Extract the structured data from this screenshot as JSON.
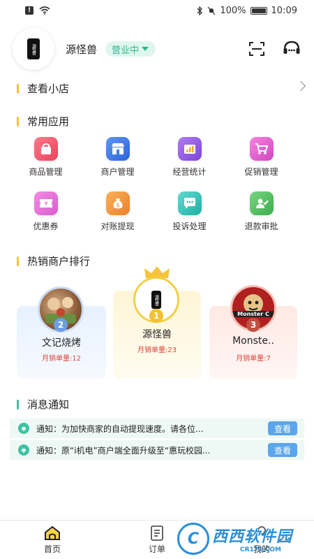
{
  "status_bar": {
    "battery": "100%",
    "time": "10:09"
  },
  "header": {
    "shop_name": "源怪兽",
    "status_label": "营业中",
    "logo_text": "源怪兽"
  },
  "view_shop": {
    "label": "查看小店"
  },
  "apps_section": {
    "title": "常用应用",
    "items": [
      {
        "label": "商品管理",
        "icon": "shopping-bag-icon",
        "color": "#f25a6e"
      },
      {
        "label": "商户管理",
        "icon": "store-icon",
        "color": "#3f7de8"
      },
      {
        "label": "经营统计",
        "icon": "stats-chart-icon",
        "color": "#9b5de5"
      },
      {
        "label": "促销管理",
        "icon": "cart-icon",
        "color": "#e85fd0"
      },
      {
        "label": "优惠券",
        "icon": "coupon-icon",
        "color": "#e76bd6"
      },
      {
        "label": "对账提现",
        "icon": "money-bag-icon",
        "color": "#f49a3a"
      },
      {
        "label": "投诉处理",
        "icon": "chat-icon",
        "color": "#2cc6b8"
      },
      {
        "label": "退款审批",
        "icon": "user-check-icon",
        "color": "#48c25b"
      }
    ]
  },
  "ranking": {
    "title": "热销商户排行",
    "items": [
      {
        "rank": "1",
        "name": "源怪兽",
        "sales": "月销单量:23"
      },
      {
        "rank": "2",
        "name": "文记烧烤",
        "sales": "月销单量:12"
      },
      {
        "rank": "3",
        "name": "Monste..",
        "sales": "月销单量:7",
        "logo_text": "Monster C"
      }
    ]
  },
  "notices": {
    "title": "消息通知",
    "items": [
      {
        "text": "通知：为加快商家的自动提现速度。请各位...",
        "button": "查看"
      },
      {
        "text": "通知：原“i机电”商户端全面升级至“惠玩校园...",
        "button": "查看"
      }
    ]
  },
  "bottom_nav": [
    {
      "label": "首页",
      "icon": "home-icon"
    },
    {
      "label": "订单",
      "icon": "order-icon"
    },
    {
      "label": "我的",
      "icon": "user-icon"
    }
  ],
  "watermark": {
    "text": "西西软件园",
    "sub": "CR173.COM"
  },
  "colors": {
    "accent_green": "#2fb58c",
    "section_bar_yellow": "#f4c530",
    "section_bar_teal": "#3cc3a1",
    "sales_red": "#d9453c",
    "view_button_blue": "#5ba6ea"
  }
}
